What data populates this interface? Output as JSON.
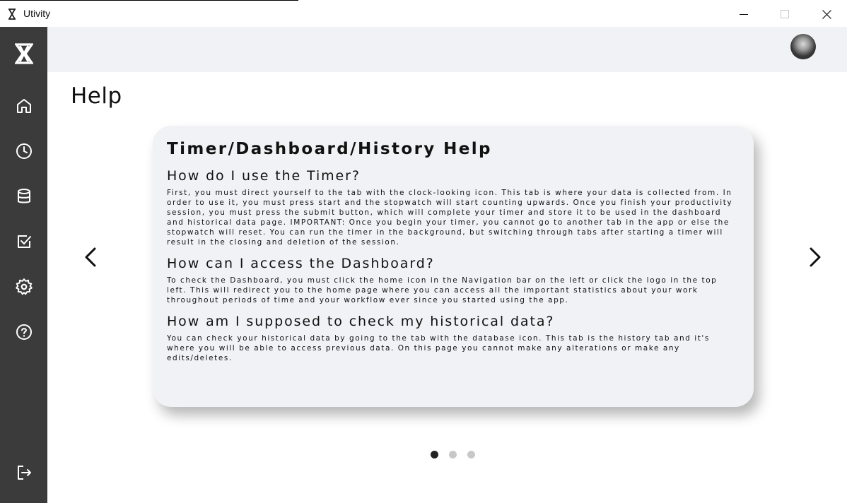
{
  "window": {
    "title": "Utivity"
  },
  "sidebar": {
    "items": [
      {
        "name": "logo",
        "icon": "hourglass-icon"
      },
      {
        "name": "home",
        "icon": "home-icon"
      },
      {
        "name": "timer",
        "icon": "clock-icon"
      },
      {
        "name": "history",
        "icon": "database-icon"
      },
      {
        "name": "tasks",
        "icon": "checkbox-icon"
      },
      {
        "name": "settings",
        "icon": "gear-icon"
      },
      {
        "name": "help",
        "icon": "help-icon"
      },
      {
        "name": "logout",
        "icon": "logout-icon"
      }
    ]
  },
  "header": {
    "avatar_icon": "user-avatar"
  },
  "page": {
    "title": "Help"
  },
  "carousel": {
    "card_title": "Timer/Dashboard/History Help",
    "sections": [
      {
        "question": "How do I use the Timer?",
        "answer": "First, you must direct yourself to the tab with the clock-looking icon. This tab is where your data is collected from. In order to use it, you must press start and the stopwatch will start counting upwards. Once you finish your productivity session, you must press the submit button, which will complete your timer and store it to be used in the dashboard and historical data page. IMPORTANT: Once you begin your timer, you cannot go to another tab in the app or else the stopwatch will reset. You can run the timer in the background, but switching through tabs after starting a timer will result in the closing and deletion of the session."
      },
      {
        "question": "How can I access the Dashboard?",
        "answer": "To check the Dashboard, you must click the home icon in the Navigation bar on the left or click the logo in the top left. This will redirect you to the home page where you can access all the important statistics about your work throughout periods of time and your workflow ever since you started using the app."
      },
      {
        "question": "How am I supposed to check my historical data?",
        "answer": "You can check your historical data by going to the tab with the database icon. This tab is the history tab and it's where you will be able to access previous data. On this page you cannot make any alterations or make any edits/deletes."
      }
    ],
    "page_count": 3,
    "active_page": 1,
    "prev_icon": "chevron-left-icon",
    "next_icon": "chevron-right-icon"
  },
  "colors": {
    "sidebar_bg": "#3b3b3b",
    "header_bg": "#f1f2f5",
    "card_bg": "#f1f2f5",
    "dot_active": "#222222",
    "dot_inactive": "#c8c8c8"
  }
}
